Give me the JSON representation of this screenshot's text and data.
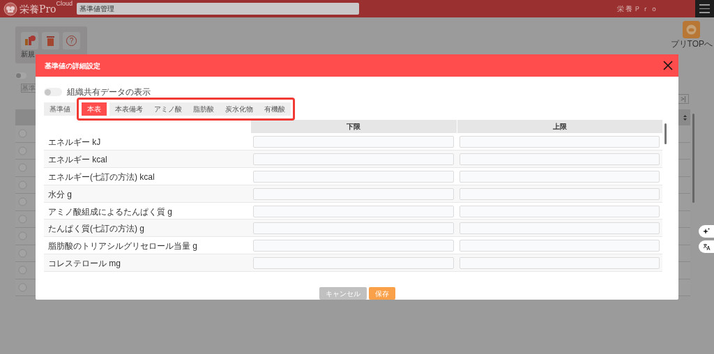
{
  "app_header": {
    "logo_text": "栄養Pro",
    "logo_superscript": "Cloud",
    "search_value": "基準値管理",
    "brand_label": "栄養Ｐｒｏ"
  },
  "background_page": {
    "toolbar_label": "新規",
    "help_glyph": "?",
    "filter_toggle": {
      "on": false
    },
    "filter_field": "基準",
    "app_top_label": "プリTOPへ",
    "pagination_last": ">|"
  },
  "dialog": {
    "title": "基準値の詳細設定",
    "shared_toggle": {
      "label": "組織共有データの表示",
      "on": false
    },
    "tabs": [
      {
        "label": "基準値",
        "selected": false
      },
      {
        "label": "本表",
        "selected": true
      },
      {
        "label": "本表備考",
        "selected": false
      },
      {
        "label": "アミノ酸",
        "selected": false
      },
      {
        "label": "脂肪酸",
        "selected": false
      },
      {
        "label": "炭水化物",
        "selected": false
      },
      {
        "label": "有機酸",
        "selected": false
      }
    ],
    "columns": [
      "下限",
      "上限"
    ],
    "rows": [
      {
        "label": "エネルギー kJ"
      },
      {
        "label": "エネルギー kcal"
      },
      {
        "label": "エネルギー(七訂の方法) kcal"
      },
      {
        "label": "水分 g"
      },
      {
        "label": "アミノ酸組成によるたんぱく質 g"
      },
      {
        "label": "たんぱく質(七訂の方法) g"
      },
      {
        "label": "脂肪酸のトリアシルグリセロール当量 g"
      },
      {
        "label": "コレステロール mg"
      }
    ],
    "buttons": [
      {
        "label": "キャンセル",
        "kind": "cancel"
      },
      {
        "label": "保存",
        "kind": "save"
      }
    ]
  }
}
